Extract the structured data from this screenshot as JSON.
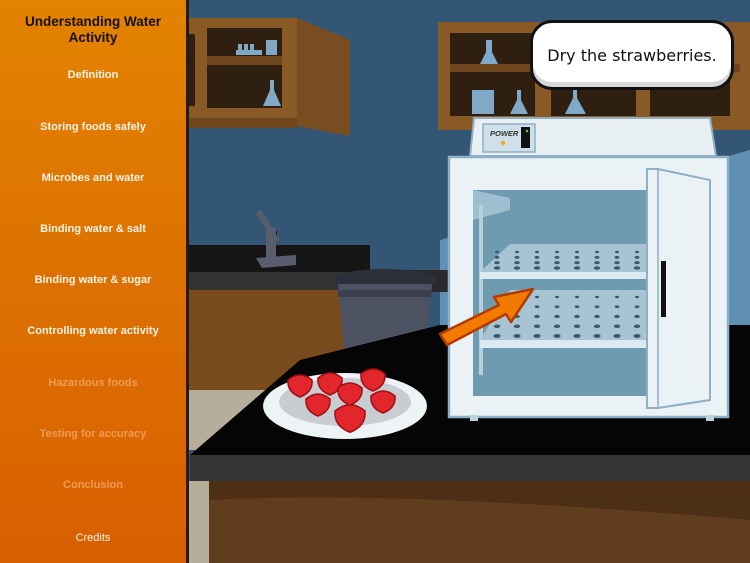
{
  "sidebar": {
    "title_line1": "Understanding Water",
    "title_line2": "Activity",
    "items": [
      {
        "label": "Definition",
        "state": "enabled"
      },
      {
        "label": "Storing foods safely",
        "state": "enabled"
      },
      {
        "label": "Microbes and water",
        "state": "enabled"
      },
      {
        "label": "Binding water & salt",
        "state": "enabled"
      },
      {
        "label": "Binding water & sugar",
        "state": "enabled"
      },
      {
        "label": "Controlling water activity",
        "state": "enabled"
      },
      {
        "label": "Hazardous foods",
        "state": "disabled"
      },
      {
        "label": "Testing for accuracy",
        "state": "disabled"
      },
      {
        "label": "Conclusion",
        "state": "disabled"
      },
      {
        "label": "Credits",
        "state": "enabled"
      }
    ]
  },
  "scene": {
    "instruction": "Dry the strawberries.",
    "oven_power_label": "POWER",
    "strawberry_count": 7
  },
  "colors": {
    "sidebar_top": "#e38300",
    "sidebar_bottom": "#d95f00",
    "wall": "#345675",
    "cabinet": "#8a5a26",
    "countertop": "#111111",
    "arrow": "#f07a00"
  }
}
